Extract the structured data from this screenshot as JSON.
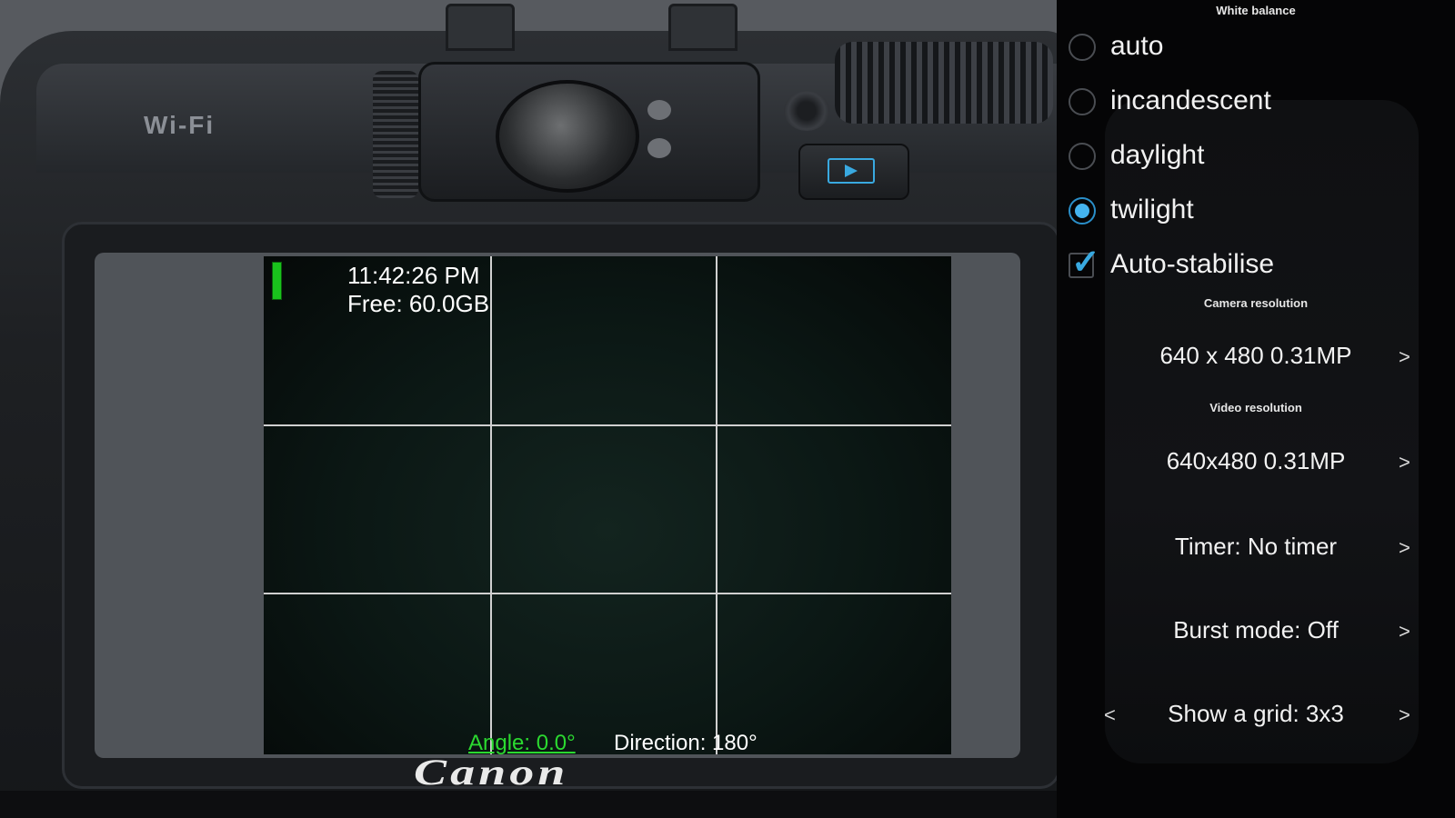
{
  "camera": {
    "wifi_label": "Wi-Fi",
    "brand": "Canon"
  },
  "preview": {
    "time": "11:42:26 PM",
    "free_space": "Free: 60.0GB",
    "angle": "Angle: 0.0°",
    "direction": "Direction: 180°",
    "grid": "3x3",
    "colors": {
      "angle_text": "#2bd930",
      "level_bar": "#19c21c"
    }
  },
  "settings": {
    "white_balance": {
      "title": "White balance",
      "options": [
        {
          "label": "auto",
          "selected": false
        },
        {
          "label": "incandescent",
          "selected": false
        },
        {
          "label": "daylight",
          "selected": false
        },
        {
          "label": "twilight",
          "selected": true
        }
      ]
    },
    "auto_stabilise": {
      "label": "Auto-stabilise",
      "checked": true
    },
    "camera_resolution": {
      "title": "Camera resolution",
      "value": "640 x 480 0.31MP",
      "next": ">"
    },
    "video_resolution": {
      "title": "Video resolution",
      "value": "640x480 0.31MP",
      "next": ">"
    },
    "timer": {
      "value": "Timer: No timer",
      "next": ">"
    },
    "burst_mode": {
      "value": "Burst mode: Off",
      "next": ">"
    },
    "grid": {
      "value": "Show a grid: 3x3",
      "prev": "<",
      "next": ">"
    },
    "accent_color": "#44b3ee"
  }
}
